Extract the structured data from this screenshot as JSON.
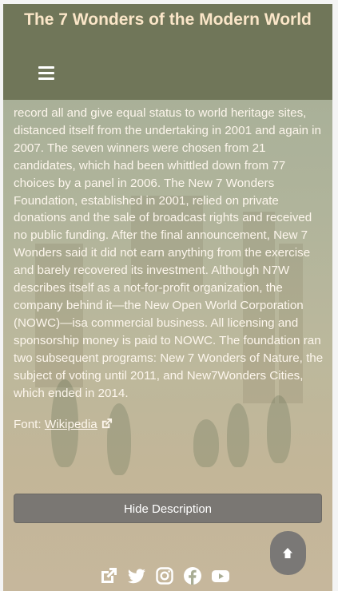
{
  "header": {
    "title": "The 7 Wonders of the Modern World",
    "menu_icon": "hamburger-menu-icon"
  },
  "main": {
    "description": "record all and give equal status to world heritage sites, distanced itself from the undertaking in 2001 and again in 2007. The seven winners were chosen from 21 candidates, which had been whittled down from 77 choices by a panel in 2006. The New 7 Wonders Foundation, established in 2001, relied on private donations and the sale of broadcast rights and received no public funding. After the final announcement, New 7 Wonders said it did not earn anything from the exercise and barely recovered its investment. Although N7W describes itself as a not-for-profit organization, the company behind it—the New Open World Corporation (NOWC)—isa commercial business. All licensing and sponsorship money is paid to NOWC. The foundation ran two subsequent programs: New 7 Wonders of Nature, the subject of voting until 2011, and New7Wonders Cities, which ended in 2014.",
    "source_label": "Font:",
    "source_link": "Wikipedia",
    "hide_button": "Hide Description"
  },
  "footer": {
    "icons": [
      "external-link-icon",
      "twitter-icon",
      "instagram-icon",
      "facebook-icon",
      "youtube-icon"
    ],
    "scroll_top_icon": "arrow-up-icon"
  },
  "colors": {
    "header_bg": "#707659",
    "title_text": "#fbe6c8",
    "body_text": "#fdf6ec",
    "button_bg": "#7a7773"
  }
}
